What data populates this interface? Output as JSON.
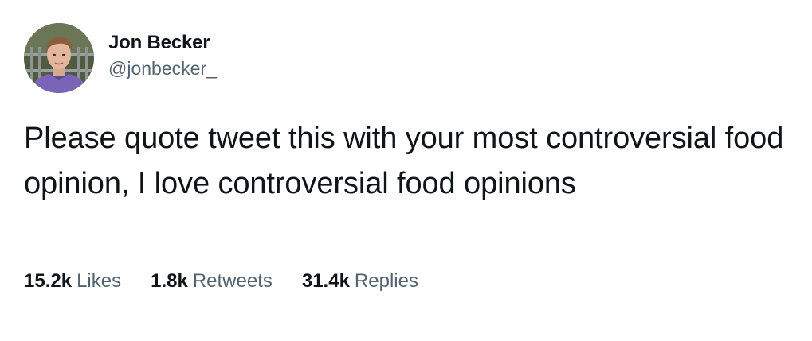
{
  "author": {
    "display_name": "Jon Becker",
    "handle": "@jonbecker_",
    "avatar_icon": "profile-photo"
  },
  "tweet": {
    "text": "Please quote tweet this with your most controversial food opinion, I love controversial food opinions"
  },
  "stats": [
    {
      "count": "15.2k",
      "label": "Likes"
    },
    {
      "count": "1.8k",
      "label": "Retweets"
    },
    {
      "count": "31.4k",
      "label": "Replies"
    }
  ],
  "colors": {
    "text_primary": "#0f1419",
    "text_secondary": "#536471",
    "background": "#ffffff"
  }
}
